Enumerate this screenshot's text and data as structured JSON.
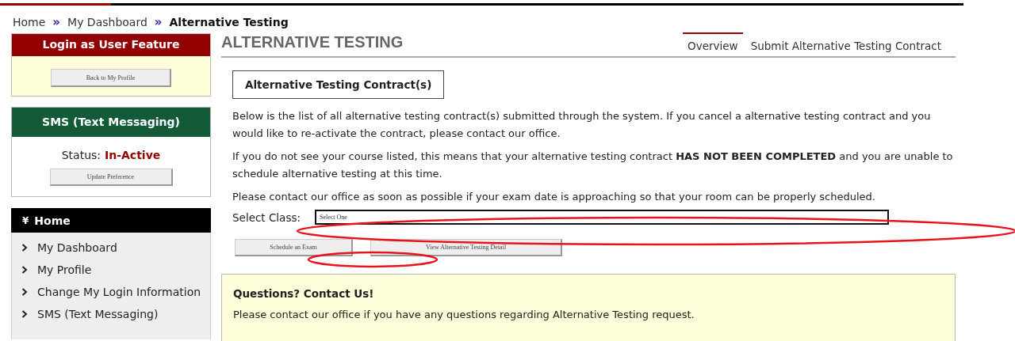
{
  "breadcrumb": [
    {
      "label": "Home",
      "current": false
    },
    {
      "label": "My Dashboard",
      "current": false
    },
    {
      "label": "Alternative Testing",
      "current": true
    }
  ],
  "breadcrumb_separator": "»",
  "sidebar": {
    "login_box": {
      "title": "Login as User Feature",
      "button": "Back to My Profile"
    },
    "sms_box": {
      "title": "SMS (Text Messaging)",
      "status_label": "Status:",
      "status_value": "In-Active",
      "button": "Update Preference"
    },
    "nav": {
      "icon": "¥",
      "title": "Home",
      "items": [
        {
          "label": "My Dashboard"
        },
        {
          "label": "My Profile"
        },
        {
          "label": "Change My Login Information"
        },
        {
          "label": "SMS (Text Messaging)"
        }
      ]
    }
  },
  "page_title": "ALTERNATIVE TESTING",
  "tabs": [
    {
      "label": "Overview",
      "selected": true
    },
    {
      "label": "Submit Alternative Testing Contract",
      "selected": false
    }
  ],
  "section_title": "Alternative Testing Contract(s)",
  "paragraphs": [
    "Below is the list of all alternative testing contract(s) submitted through the system. If you cancel a alternative testing contract and you would like to re-activate the contract, please contact our office.",
    "If you do not see your course listed, this means that your alternative testing contract **HAS NOT BEEN COMPLETED** and you are unable to schedule alternative testing at this time.",
    "Please contact our office as soon as possible if your exam date is approaching so that your room can be properly scheduled."
  ],
  "select_class": {
    "label": "Select Class:",
    "value": "Select One"
  },
  "buttons": [
    "Schedule an Exam",
    "View Alternative Testing Detail"
  ],
  "contact": {
    "title": "Questions? Contact Us!",
    "text": "Please contact our office if you have any questions regarding Alternative Testing request."
  }
}
